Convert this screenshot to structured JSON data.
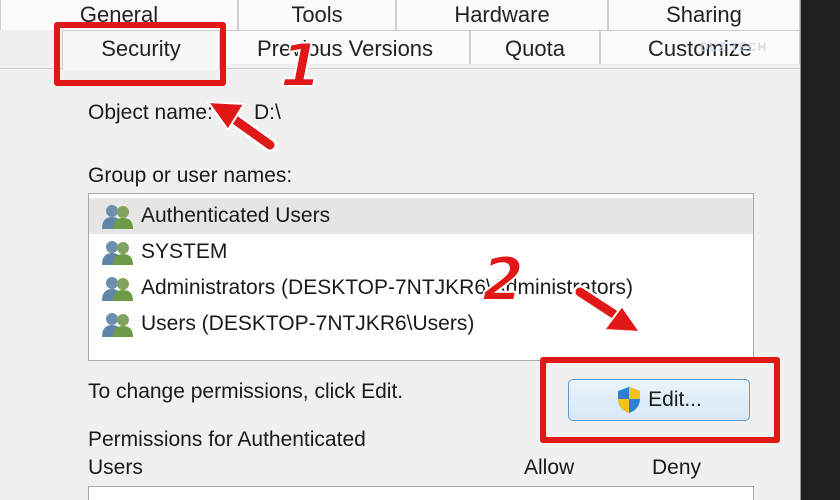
{
  "tabs_row1": [
    {
      "label": "General"
    },
    {
      "label": "Tools"
    },
    {
      "label": "Hardware"
    },
    {
      "label": "Sharing"
    }
  ],
  "tabs_row2": [
    {
      "label": "Security",
      "active": true
    },
    {
      "label": "Previous Versions"
    },
    {
      "label": "Quota"
    },
    {
      "label": "Customize"
    }
  ],
  "object_name": {
    "label": "Object name:",
    "value": "D:\\"
  },
  "group_label": "Group or user names:",
  "users": [
    {
      "name": "Authenticated Users",
      "selected": true
    },
    {
      "name": "SYSTEM"
    },
    {
      "name": "Administrators (DESKTOP-7NTJKR6\\Administrators)"
    },
    {
      "name": "Users (DESKTOP-7NTJKR6\\Users)"
    }
  ],
  "change_hint": "To change permissions, click Edit.",
  "edit_button": {
    "label": "Edit..."
  },
  "permissions": {
    "label_line1": "Permissions for Authenticated",
    "label_line2": "Users",
    "allow": "Allow",
    "deny": "Deny"
  },
  "annotations": {
    "step1": "1",
    "step2": "2",
    "color": "#e01818"
  },
  "watermark": "DLZ TECH"
}
